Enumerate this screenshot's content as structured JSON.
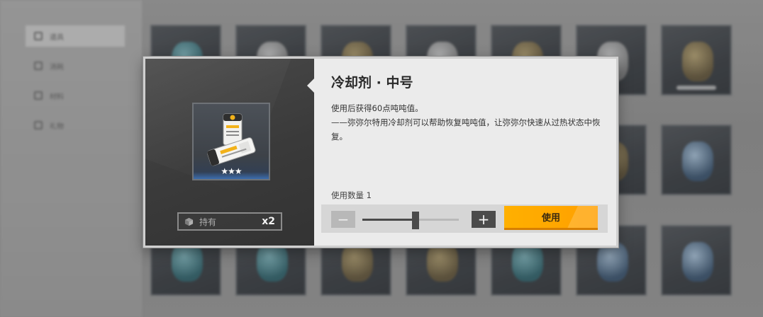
{
  "background": {
    "sidebar": [
      {
        "label": "道具"
      },
      {
        "label": "消耗"
      },
      {
        "label": "材料"
      },
      {
        "label": "礼物"
      }
    ]
  },
  "popup": {
    "item": {
      "title": "冷却剂 · 中号",
      "stars": "★★★",
      "rarity_stars": 3,
      "description_line1": "使用后获得60点吨吨值。",
      "description_line2": "——弥弥尔特用冷却剂可以帮助恢复吨吨值，让弥弥尔快速从过热状态中恢复。"
    },
    "owned": {
      "label": "持有",
      "count": "x2"
    },
    "quantity": {
      "label": "使用数量 1",
      "value": 1,
      "slider_fraction": 0.55,
      "minus_symbol": "−",
      "plus_symbol": "+"
    },
    "use_button_label": "使用",
    "colors": {
      "accent": "#ffa800",
      "panel_dark": "#3a3a3a",
      "panel_light": "#ebebeb"
    }
  }
}
